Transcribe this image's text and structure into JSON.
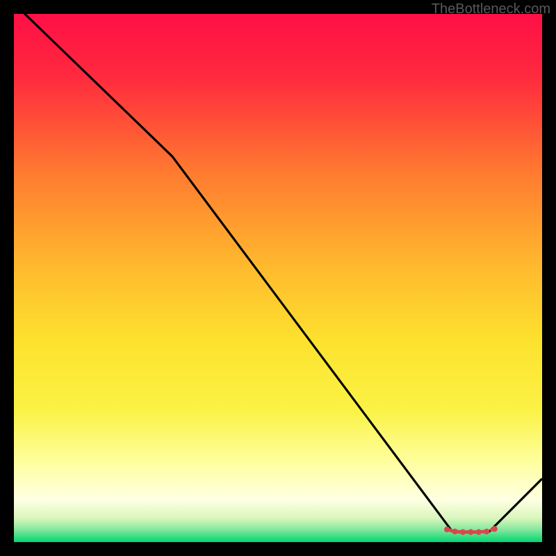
{
  "watermark": "TheBottleneck.com",
  "chart_data": {
    "type": "line",
    "title": "",
    "xlabel": "",
    "ylabel": "",
    "xlim": [
      0,
      100
    ],
    "ylim": [
      0,
      100
    ],
    "background_gradient": {
      "top": "#ff0f46",
      "mid_upper": "#ffb82f",
      "mid": "#fcee2e",
      "lower": "#ffffa7",
      "near_bottom": "#d6f7a7",
      "bottom": "#00d670"
    },
    "series": [
      {
        "name": "bottleneck-curve",
        "color": "#000000",
        "x": [
          0,
          30,
          83,
          90,
          100
        ],
        "y": [
          102,
          73,
          2,
          2,
          12
        ]
      },
      {
        "name": "optimal-marker",
        "type": "scatter",
        "color": "#d84a4a",
        "x": [
          82,
          83.5,
          85,
          86.5,
          88,
          89.5,
          91
        ],
        "y": [
          2.4,
          2.0,
          1.9,
          1.9,
          1.9,
          2.0,
          2.5
        ]
      }
    ]
  }
}
